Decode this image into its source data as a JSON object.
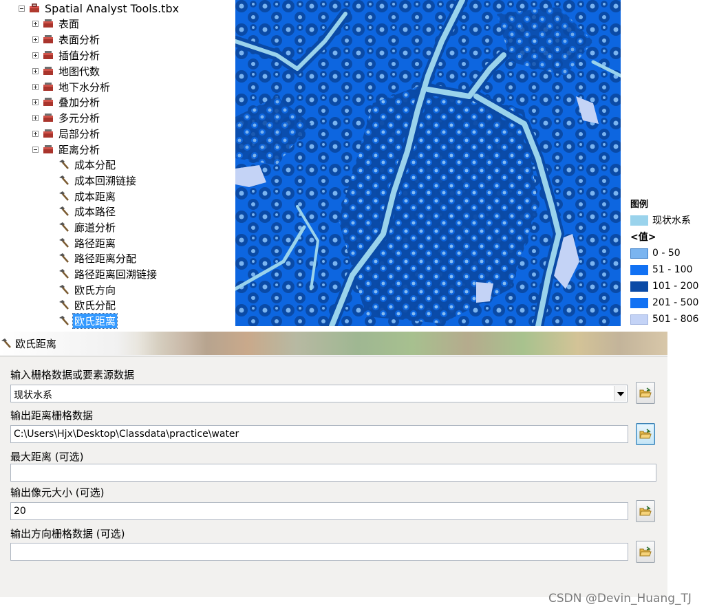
{
  "tree": {
    "root": {
      "label": "Spatial Analyst Tools.tbx",
      "icon": "toolbox-icon"
    },
    "toolsets": [
      {
        "label": "表面",
        "icon": "toolset-icon"
      },
      {
        "label": "表面分析",
        "icon": "toolset-icon"
      },
      {
        "label": "插值分析",
        "icon": "toolset-icon"
      },
      {
        "label": "地图代数",
        "icon": "toolset-icon"
      },
      {
        "label": "地下水分析",
        "icon": "toolset-icon"
      },
      {
        "label": "叠加分析",
        "icon": "toolset-icon"
      },
      {
        "label": "多元分析",
        "icon": "toolset-icon"
      },
      {
        "label": "局部分析",
        "icon": "toolset-icon"
      }
    ],
    "expanded": {
      "label": "距离分析",
      "icon": "toolset-icon"
    },
    "tools": [
      {
        "label": "成本分配"
      },
      {
        "label": "成本回溯链接"
      },
      {
        "label": "成本距离"
      },
      {
        "label": "成本路径"
      },
      {
        "label": "廊道分析"
      },
      {
        "label": "路径距离"
      },
      {
        "label": "路径距离分配"
      },
      {
        "label": "路径距离回溯链接"
      },
      {
        "label": "欧氏方向"
      },
      {
        "label": "欧氏分配"
      },
      {
        "label": "欧氏距离",
        "selected": true
      }
    ],
    "tool_icon": "hammer-icon"
  },
  "map": {
    "colors": {
      "water": "#9ad3ec",
      "near": "#7ab4f0",
      "mid": "#0d66e0",
      "far": "#0a4aa6",
      "far2": "#1171f3",
      "farthest": "#c4d3f6"
    }
  },
  "legend": {
    "title": "图例",
    "layer": {
      "label": "现状水系",
      "color": "#9ad3ec"
    },
    "value_header": "<值>",
    "classes": [
      {
        "label": "0 - 50",
        "color": "#7ab4f0"
      },
      {
        "label": "51 - 100",
        "color": "#1171f3"
      },
      {
        "label": "101 - 200",
        "color": "#0a4aa6"
      },
      {
        "label": "201 - 500",
        "color": "#1171f3"
      },
      {
        "label": "501 - 806",
        "color": "#c4d3f6"
      }
    ]
  },
  "dialog": {
    "title": "欧氏距离",
    "fields": [
      {
        "label": "输入栅格数据或要素源数据",
        "value": "现状水系",
        "type": "combo"
      },
      {
        "label": "输出距离栅格数据",
        "value": "C:\\Users\\Hjx\\Desktop\\Classdata\\practice\\water",
        "type": "text"
      },
      {
        "label": "最大距离 (可选)",
        "value": "",
        "type": "text"
      },
      {
        "label": "输出像元大小 (可选)",
        "value": "20",
        "type": "text"
      },
      {
        "label": "输出方向栅格数据 (可选)",
        "value": "",
        "type": "text"
      }
    ]
  },
  "watermark": "CSDN @Devin_Huang_TJ"
}
